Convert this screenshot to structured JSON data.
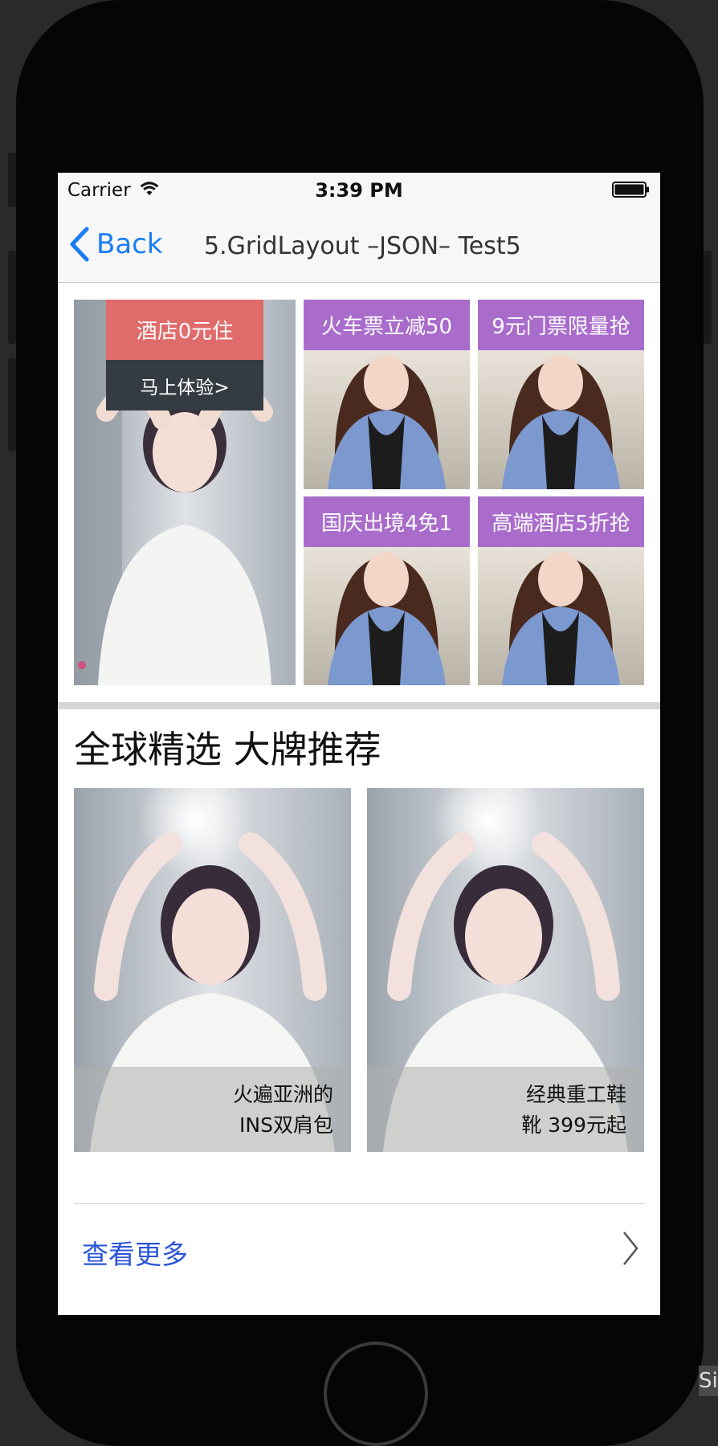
{
  "status_bar": {
    "carrier": "Carrier",
    "time": "3:39 PM",
    "wifi_icon": "wifi-icon",
    "battery_icon": "battery-full-icon"
  },
  "nav": {
    "back_label": "Back",
    "title": "5.GridLayout –JSON– Test5"
  },
  "grid": {
    "main": {
      "tag_top": "酒店0元住",
      "tag_bottom": "马上体验>",
      "tag_top_color": "#e06b6b",
      "tag_bottom_color": "#353b42"
    },
    "tile_label_color": "#a96ccb",
    "tiles": [
      {
        "label": "火车票立减50"
      },
      {
        "label": "9元门票限量抢"
      },
      {
        "label": "国庆出境4免1"
      },
      {
        "label": "高端酒店5折抢"
      }
    ]
  },
  "section": {
    "title": "全球精选 大牌推荐"
  },
  "promos": [
    {
      "line1": "火遍亚洲的",
      "line2": "INS双肩包"
    },
    {
      "line1": "经典重工鞋",
      "line2": "靴 399元起"
    }
  ],
  "more": {
    "label": "查看更多",
    "label_color": "#2a55d8",
    "icon": "chevron-right-icon"
  },
  "accent_color": "#1a7cf5",
  "corner_text": "Si"
}
